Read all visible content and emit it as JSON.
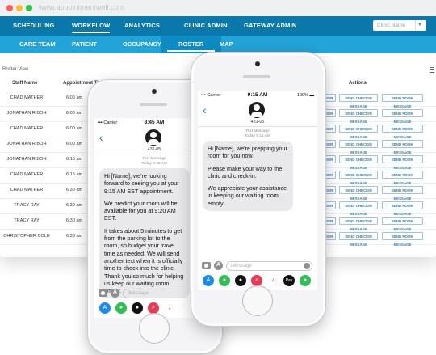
{
  "browser": {
    "url": "www.appointmentwell.com"
  },
  "nav_primary": {
    "items": [
      {
        "label": "SCHEDULING",
        "active": false
      },
      {
        "label": "WORKFLOW",
        "active": true
      },
      {
        "label": "ANALYTICS",
        "active": false
      },
      {
        "label": "CLINIC ADMIN",
        "active": false
      },
      {
        "label": "GATEWAY ADMIN",
        "active": false
      }
    ],
    "clinic_select_placeholder": "Clinic Name"
  },
  "nav_secondary": {
    "items": [
      {
        "label": "CARE TEAM",
        "active": false
      },
      {
        "label": "PATIENT",
        "active": false
      },
      {
        "label": "OCCUPANCY",
        "active": false
      },
      {
        "label": "ROSTER",
        "active": true
      },
      {
        "label": "MAP",
        "active": false
      }
    ]
  },
  "roster": {
    "view_label": "Roster View",
    "headers": {
      "staff": "Staff Name",
      "time": "Appointment Time",
      "actions": "Actions"
    },
    "button_labels": {
      "reminder": "INDER",
      "checkin": "SEND CHECKIN MESSAGE",
      "room": "SEND ROOM MESSAGE"
    },
    "rows": [
      {
        "staff": "CHAD MATHER",
        "time": "6:00 am"
      },
      {
        "staff": "JONATHAN RIBOH",
        "time": "6:00 am"
      },
      {
        "staff": "CHAD MATHER",
        "time": "6:00 am"
      },
      {
        "staff": "JONATHAN RIBOH",
        "time": "6:00 am"
      },
      {
        "staff": "JONATHAN RIBOH",
        "time": "6:15 am"
      },
      {
        "staff": "CHAD MATHER",
        "time": "6:15 am"
      },
      {
        "staff": "CHAD MATHER",
        "time": "6:30 am"
      },
      {
        "staff": "TRACY RAY",
        "time": "6:30 am"
      },
      {
        "staff": "TRACY RAY",
        "time": "6:30 am"
      },
      {
        "staff": "CHRISTOPHER COLE",
        "time": "6:30 am"
      }
    ]
  },
  "phone_left": {
    "carrier": "Carrier",
    "clock": "8:45 AM",
    "contact": "431-05",
    "meta_title": "Text Message",
    "meta_time": "Today 8:45 AM",
    "paragraphs": [
      "Hi [Name], we're looking forward to seeing you at your 9:15 AM EST appointment.",
      "We predict your room will be available for you at 9:20 AM EST.",
      "It takes about 5 minutes to get from the parking lot to the room, so budget your travel time as needed. We will send another text when it is officially time to check into the clinic. Thank you so much for helping us keep our waiting room empty."
    ],
    "input_placeholder": "iMessage"
  },
  "phone_right": {
    "carrier": "Carrier",
    "clock": "9:15 AM",
    "status_right": "100%",
    "contact": "431-05",
    "meta_title": "Text Message",
    "meta_time": "Today 9:15 AM",
    "paragraphs": [
      "Hi [Name], we're prepping your room for you now.",
      "Please make your way to the clinic and check-in.",
      "We appreciate your assistance in keeping our waiting room empty."
    ],
    "input_placeholder": "iMessage"
  },
  "tray_icons": [
    "appstore-icon",
    "activity-icon",
    "memoji-icon",
    "search-icon",
    "music-icon",
    "pay-icon"
  ]
}
